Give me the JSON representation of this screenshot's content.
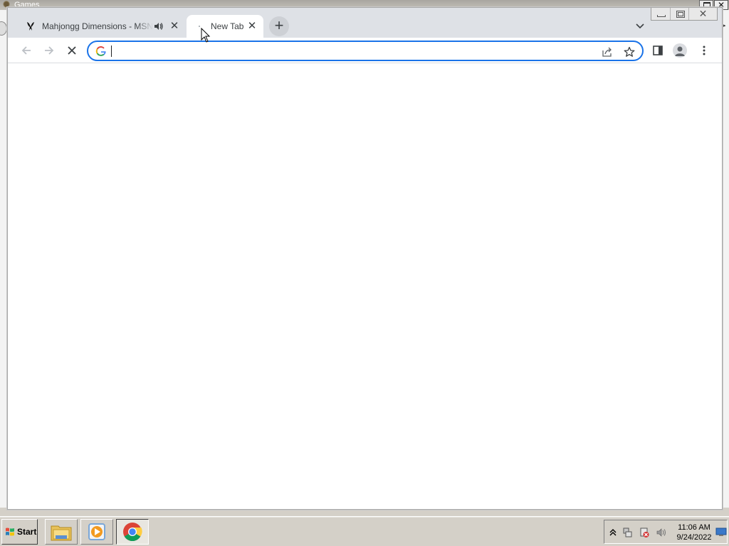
{
  "background_window": {
    "title": "Games"
  },
  "browser": {
    "tabs": [
      {
        "title": "Mahjongg Dimensions - MSN Games",
        "favicon": "butterfly-icon",
        "audio": true,
        "active": false
      },
      {
        "title": "New Tab",
        "favicon": "loading-dot",
        "audio": false,
        "active": true
      }
    ],
    "new_tab_icon": "plus-icon",
    "tab_search_icon": "chevron-down-icon",
    "window_controls": [
      "minimize-icon",
      "restore-icon",
      "close-icon"
    ],
    "toolbar": {
      "back_icon": "arrow-left-icon",
      "forward_icon": "arrow-right-icon",
      "stop_icon": "close-icon",
      "omnibox": {
        "value": "",
        "placeholder": "",
        "leading_icon": "google-g-icon"
      },
      "share_icon": "share-icon",
      "bookmark_icon": "star-icon",
      "side_panel_icon": "side-panel-icon",
      "profile_icon": "person-icon",
      "menu_icon": "kebab-menu-icon"
    },
    "colors": {
      "accent": "#1a73e8",
      "tabstrip": "#dee1e6"
    }
  },
  "taskbar": {
    "start_label": "Start",
    "apps": [
      {
        "name": "file-explorer-icon",
        "active": false
      },
      {
        "name": "media-player-icon",
        "active": false
      },
      {
        "name": "chrome-icon",
        "active": true
      }
    ],
    "tray_icons": [
      "chevron-up-icon",
      "network-icon",
      "action-center-icon",
      "volume-icon"
    ],
    "clock": {
      "time": "11:06 AM",
      "date": "9/24/2022"
    },
    "show_desktop_icon": "show-desktop-icon"
  }
}
